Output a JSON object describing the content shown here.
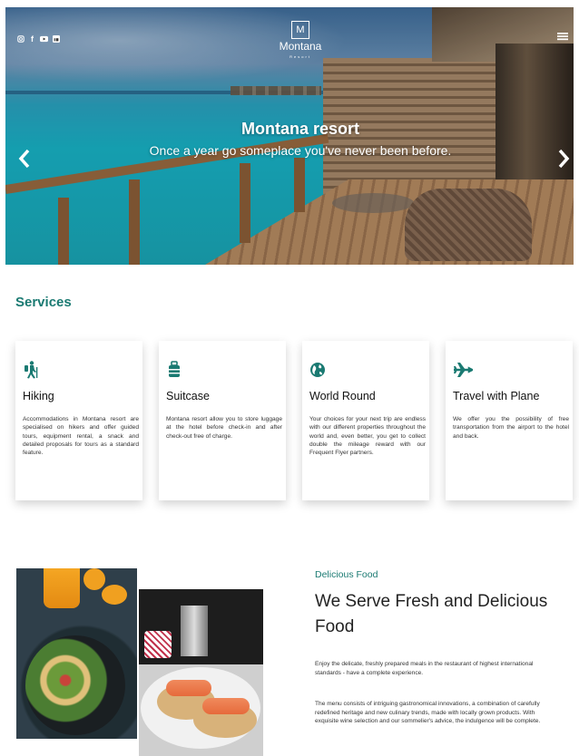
{
  "header": {
    "social_icons": [
      "instagram-icon",
      "facebook-icon",
      "youtube-icon",
      "linkedin-icon"
    ],
    "logo_letter": "M",
    "logo_name": "Montana",
    "logo_sub": "Resort",
    "menu_icon": "hamburger-menu-icon"
  },
  "hero": {
    "title": "Montana resort",
    "subtitle": "Once a year go someplace you've never been before.",
    "prev_icon": "chevron-left-icon",
    "next_icon": "chevron-right-icon"
  },
  "services": {
    "title": "Services",
    "accent_color": "#1a7a72",
    "items": [
      {
        "icon": "hiking-icon",
        "title": "Hiking",
        "text": "Accommodations in Montana resort are specialised on hikers and offer guided tours, equipment rental, a snack and detailed proposals for tours as a standard feature."
      },
      {
        "icon": "suitcase-icon",
        "title": "Suitcase",
        "text": "Montana resort allow you to store luggage at the hotel before check-in and after check-out free of charge."
      },
      {
        "icon": "globe-icon",
        "title": "World Round",
        "text": "Your choices for your next trip are endless with our different properties throughout the world and, even better, you get to collect double the mileage reward with our Frequent Flyer partners."
      },
      {
        "icon": "airplane-icon",
        "title": "Travel with Plane",
        "text": "We offer you the possibility of free transportation from the airport to the hotel and back."
      }
    ]
  },
  "food": {
    "kicker": "Delicious Food",
    "title": "We Serve Fresh and Delicious Food",
    "paragraph1": "Enjoy the delicate, freshly prepared meals in the restaurant of highest international standards - have a complete experience.",
    "paragraph2": "The menu consists of intriguing gastronomical innovations, a combination of carefully redefined heritage and new culinary trends, made with locally grown products. With exquisite wine selection and our sommelier's advice, the indulgence will be complete."
  }
}
